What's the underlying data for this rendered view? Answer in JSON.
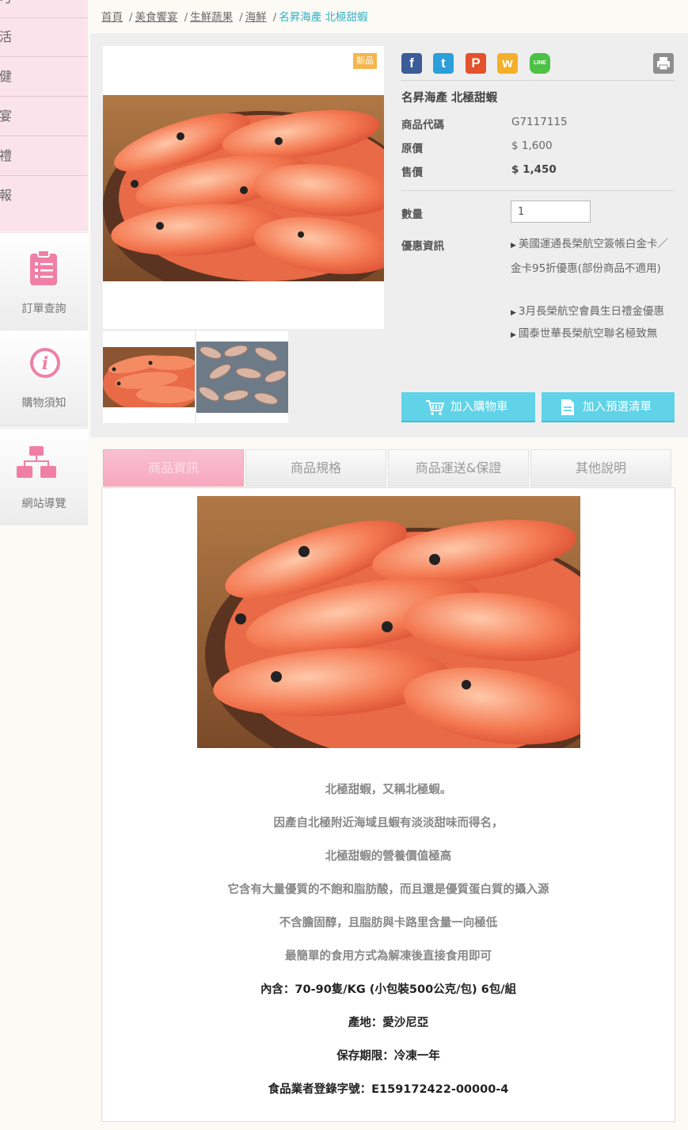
{
  "sidebar": {
    "menu_items": [
      "活",
      "健",
      "宴",
      "禮",
      "報"
    ],
    "menu_top_partial": "刁",
    "blocks": [
      {
        "label": "訂單查詢",
        "icon": "clipboard-list-icon"
      },
      {
        "label": "購物須知",
        "icon": "info-circle-icon"
      },
      {
        "label": "網站導覽",
        "icon": "sitemap-icon"
      }
    ]
  },
  "breadcrumb": {
    "items": [
      "首頁",
      "美食饗宴",
      "生鮮蔬果",
      "海鮮"
    ],
    "current": "名昇海產 北極甜蝦",
    "separator": "/"
  },
  "product": {
    "badge": "新品",
    "name": "名昇海產 北極甜蝦",
    "code_label": "商品代碼",
    "code": "G7117115",
    "orig_price_label": "原價",
    "orig_price": "$ 1,600",
    "price_label": "售價",
    "price": "$ 1,450",
    "qty_label": "數量",
    "qty_value": "1",
    "promo_label": "優惠資訊",
    "promos": [
      "美國運通長榮航空簽帳白金卡／金卡95折優惠(部份商品不適用)",
      "3月長榮航空會員生日禮金優惠",
      "國泰世華長榮航空聯名極致無"
    ],
    "add_cart_label": "加入購物車",
    "add_wishlist_label": "加入預選清單",
    "share": [
      {
        "icon": "facebook-icon",
        "glyph": "f",
        "color": "#3b5b99"
      },
      {
        "icon": "twitter-icon",
        "glyph": "t",
        "color": "#2b9fd9"
      },
      {
        "icon": "plurk-icon",
        "glyph": "P",
        "color": "#e3522c"
      },
      {
        "icon": "weibo-icon",
        "glyph": "w",
        "color": "#f3b02a"
      },
      {
        "icon": "line-icon",
        "glyph": "LINE",
        "color": "#4cc145"
      }
    ]
  },
  "tabs": [
    "商品資訊",
    "商品規格",
    "商品運送&保證",
    "其他說明"
  ],
  "description": {
    "lines": [
      "北極甜蝦，又稱北極蝦。",
      "因產自北極附近海域且蝦有淡淡甜味而得名，",
      "北極甜蝦的營養價值極高",
      "它含有大量優質的不飽和脂肪酸，而且還是優質蛋白質的攝入源",
      "不含膽固醇，且脂肪與卡路里含量一向極低",
      "最簡單的食用方式為解凍後直接食用即可"
    ],
    "specs": [
      "內含：70-90隻/KG (小包裝500公克/包) 6包/組",
      "產地：愛沙尼亞",
      "保存期限：冷凍一年",
      "食品業者登錄字號：E159172422-00000-4"
    ]
  },
  "colors": {
    "sidebar_pink": "#fbe3ec",
    "accent_cyan": "#60d3e8",
    "active_tab_pink": "#f7a8be",
    "badge_orange": "#f7b54e",
    "current_crumb": "#35b0c4"
  }
}
